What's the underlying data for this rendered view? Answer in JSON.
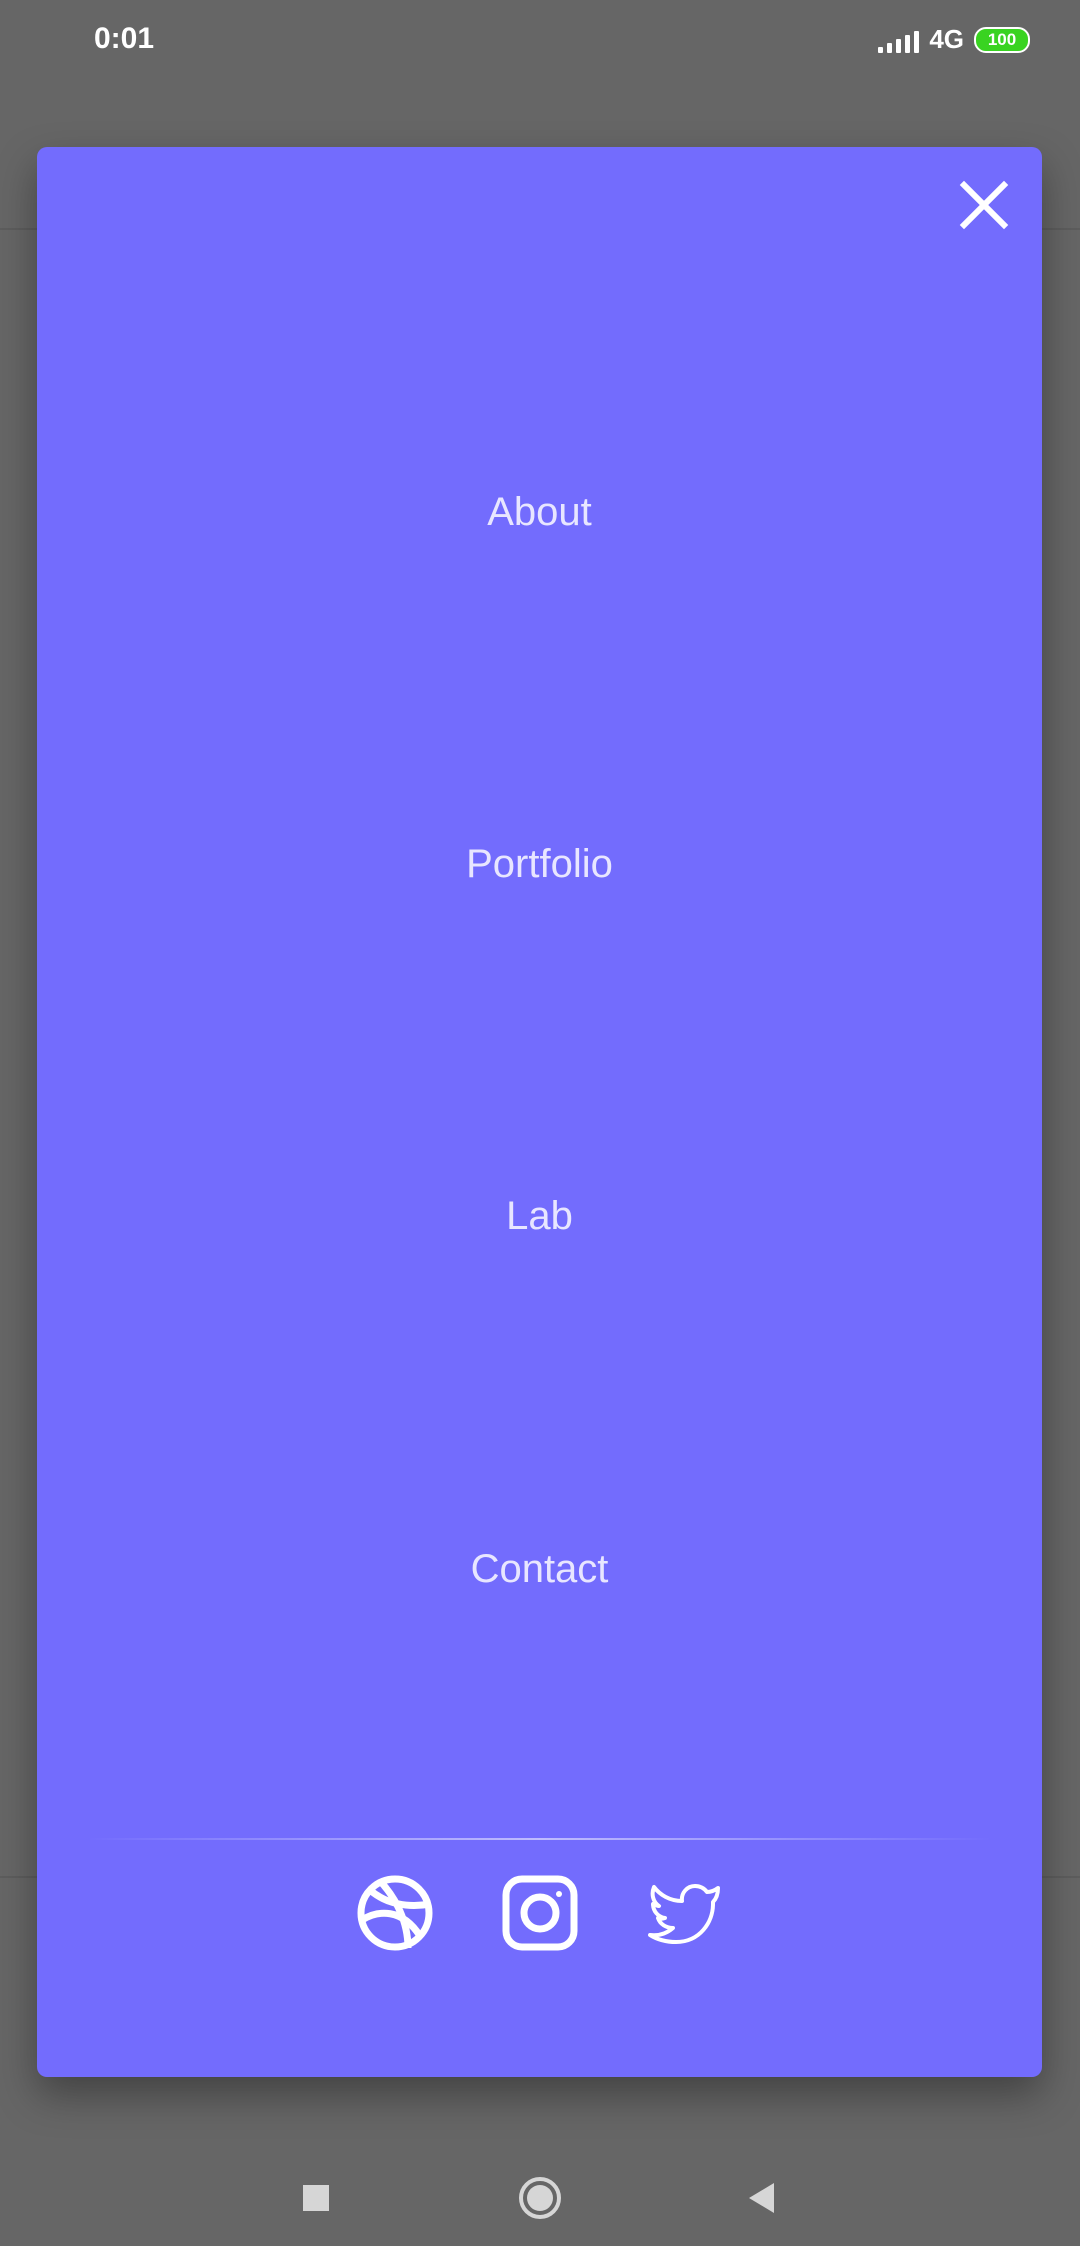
{
  "status_bar": {
    "time": "0:01",
    "network": "4G",
    "battery": "100",
    "battery_color": "#39d321"
  },
  "modal": {
    "background": "#736cfd",
    "close_icon": "close-icon",
    "items": [
      {
        "label": "About"
      },
      {
        "label": "Portfolio"
      },
      {
        "label": "Lab"
      },
      {
        "label": "Contact"
      }
    ],
    "social": [
      {
        "icon": "dribbble-icon"
      },
      {
        "icon": "instagram-icon"
      },
      {
        "icon": "twitter-icon"
      }
    ]
  },
  "nav_bar": {
    "buttons": [
      "recents-square-icon",
      "home-circle-icon",
      "back-triangle-icon"
    ]
  }
}
